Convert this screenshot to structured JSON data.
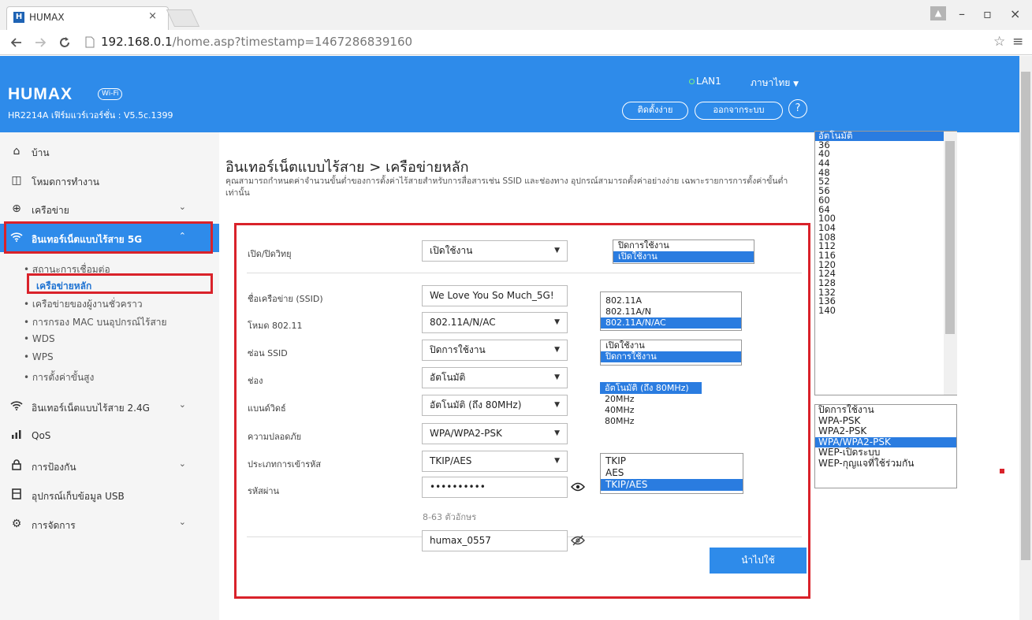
{
  "browser": {
    "tab_title": "HUMAX",
    "tab_favicon": "H",
    "tab_close": "×",
    "window_controls": {
      "minimize": "–",
      "maximize": "▫",
      "close": "×"
    },
    "url_host": "192.168.0.1",
    "url_path": "/home.asp?timestamp=1467286839160"
  },
  "header": {
    "logo": "HUMAX",
    "logo_badge": "Wi-Fi",
    "firmware": "HR2214A เฟิร์มแวร์เวอร์ชั่น : V5.5c.1399",
    "lan_status": "LAN1",
    "language": "ภาษาไทย",
    "easy_setup": "ติดตั้งง่าย",
    "logout": "ออกจากระบบ",
    "help": "?"
  },
  "sidebar": {
    "items": [
      {
        "label": "บ้าน",
        "icon": "home-icon"
      },
      {
        "label": "โหมดการทำงาน",
        "icon": "mode-icon"
      },
      {
        "label": "เครือข่าย",
        "icon": "globe-icon"
      },
      {
        "label": "อินเทอร์เน็ตแบบไร้สาย 5G",
        "icon": "wifi-icon"
      },
      {
        "label": "อินเทอร์เน็ตแบบไร้สาย 2.4G",
        "icon": "wifi-icon"
      },
      {
        "label": "QoS",
        "icon": "bars-icon"
      },
      {
        "label": "การป้องกัน",
        "icon": "lock-icon"
      },
      {
        "label": "อุปกรณ์เก็บข้อมูล USB",
        "icon": "usb-icon"
      },
      {
        "label": "การจัดการ",
        "icon": "gear-icon"
      }
    ],
    "subitems": [
      "• สถานะการเชื่อมต่อ",
      "เครือข่ายหลัก",
      "• เครือข่ายของผู้งานชั่วคราว",
      "• การกรอง MAC บนอุปกรณ์ไร้สาย",
      "• WDS",
      "• WPS",
      "• การตั้งค่าขั้นสูง"
    ]
  },
  "main": {
    "title": "อินเทอร์เน็ตแบบไร้สาย > เครือข่ายหลัก",
    "description": "คุณสามารถกำหนดค่าจำนวนขั้นต่ำของการตั้งค่าไร้สายสำหรับการสื่อสารเช่น SSID และช่องทาง อุปกรณ์สามารถตั้งค่าอย่างง่าย เฉพาะรายการการตั้งค่าขั้นต่ำเท่านั้น",
    "fields": {
      "radio": {
        "label": "เปิด/ปิดวิทยุ",
        "value": "เปิดใช้งาน"
      },
      "ssid": {
        "label": "ชื่อเครือข่าย (SSID)",
        "value": "We Love You So Much_5G!"
      },
      "mode": {
        "label": "โหมด 802.11",
        "value": "802.11A/N/AC"
      },
      "hide_ssid": {
        "label": "ซ่อน SSID",
        "value": "ปิดการใช้งาน"
      },
      "channel": {
        "label": "ช่อง",
        "value": "อัตโนมัติ"
      },
      "bandwidth": {
        "label": "แบนด์วิดธ์",
        "value": "อัตโนมัติ (ถึง 80MHz)"
      },
      "security": {
        "label": "ความปลอดภัย",
        "value": "WPA/WPA2-PSK"
      },
      "encryption": {
        "label": "ประเภทการเข้ารหัส",
        "value": "TKIP/AES"
      },
      "password": {
        "label": "รหัสผ่าน",
        "value": "••••••••••"
      },
      "password_hint": "8-63 ตัวอักษร",
      "password_plain": "humax_0557"
    },
    "apply": "นำไปใช้"
  },
  "dropdowns": {
    "radio": [
      "ปิดการใช้งาน",
      "เปิดใช้งาน"
    ],
    "mode": [
      "802.11A",
      "802.11A/N",
      "802.11A/N/AC"
    ],
    "hide_ssid": [
      "เปิดใช้งาน",
      "ปิดการใช้งาน"
    ],
    "bandwidth": [
      "อัตโนมัติ (ถึง 80MHz)",
      "20MHz",
      "40MHz",
      "80MHz"
    ],
    "encryption": [
      "TKIP",
      "AES",
      "TKIP/AES"
    ],
    "channel": [
      "อัตโนมัติ",
      "36",
      "40",
      "44",
      "48",
      "52",
      "56",
      "60",
      "64",
      "100",
      "104",
      "108",
      "112",
      "116",
      "120",
      "124",
      "128",
      "132",
      "136",
      "140"
    ],
    "security": [
      "ปิดการใช้งาน",
      "WPA-PSK",
      "WPA2-PSK",
      "WPA/WPA2-PSK",
      "WEP-เปิดระบบ",
      "WEP-กุญแจที่ใช้ร่วมกัน"
    ]
  },
  "colors": {
    "accent": "#2e8bea",
    "highlight": "#d9222a"
  }
}
